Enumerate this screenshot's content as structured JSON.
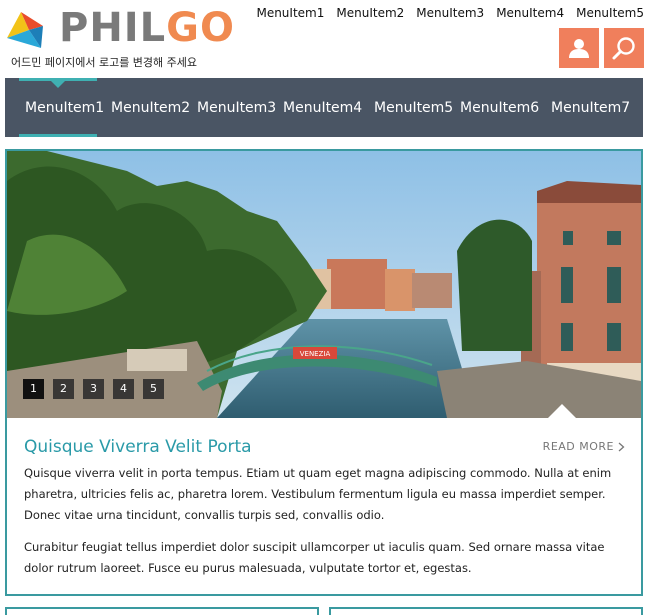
{
  "logo": {
    "part1": "PHIL",
    "part2": "GO",
    "note": "어드민 페이지에서 로고를 변경해 주세요"
  },
  "top_menu": [
    "MenuItem1",
    "MenuItem2",
    "MenuItem3",
    "MenuItem4",
    "MenuItem5"
  ],
  "icons": {
    "user": "user-icon",
    "search": "search-icon"
  },
  "main_nav": {
    "items": [
      "MenuItem1",
      "MenuItem2",
      "MenuItem3",
      "MenuItem4",
      "MenuItem5",
      "MenuItem6",
      "MenuItem7"
    ],
    "active_index": 0
  },
  "slider": {
    "dots": [
      "1",
      "2",
      "3",
      "4",
      "5"
    ],
    "active_dot": 0,
    "sign_text": "VENEZIA"
  },
  "post": {
    "title": "Quisque Viverra Velit Porta",
    "read_more": "READ MORE",
    "paragraph1": "Quisque viverra velit in porta tempus. Etiam ut quam eget magna adipiscing commodo. Nulla at enim pharetra, ultricies felis ac, pharetra lorem. Vestibulum fermentum ligula eu massa imperdiet semper. Donec vitae urna tincidunt, convallis turpis sed, convallis odio.",
    "paragraph2": "Curabitur feugiat tellus imperdiet dolor suscipit ullamcorper ut iaculis quam. Sed ornare massa vitae dolor rutrum laoreet. Fusce eu purus malesuada, vulputate tortor et, egestas."
  },
  "colors": {
    "accent": "#3fb0b2",
    "nav_bg": "#4a5564",
    "icon_btn": "#f07f5c",
    "title": "#2a9aa8",
    "logo_gray": "#7a7a7a",
    "logo_orange": "#f08a50"
  }
}
